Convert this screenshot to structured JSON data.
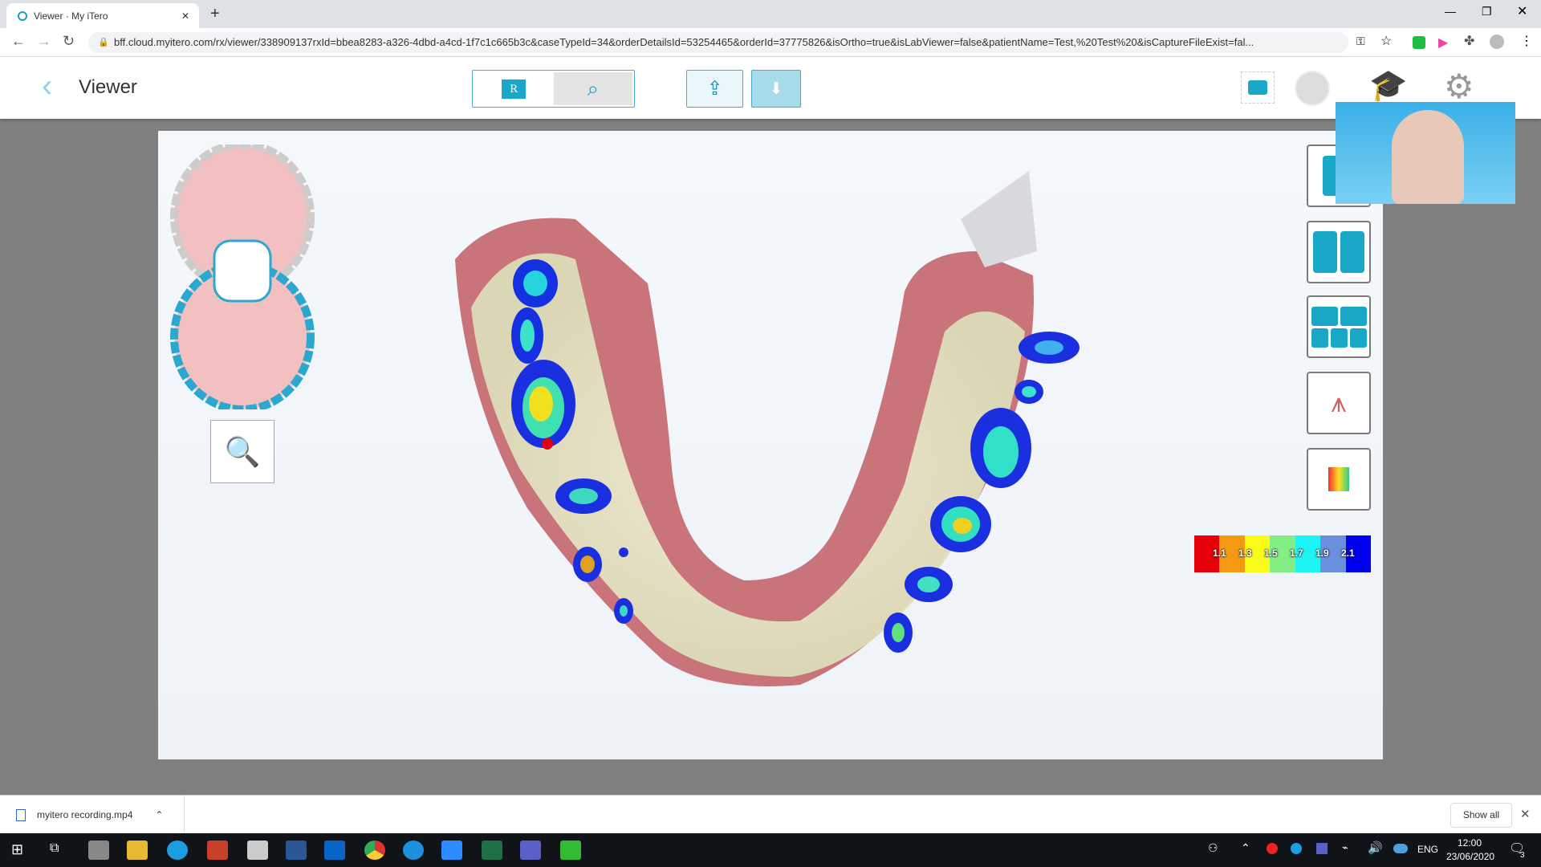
{
  "browser": {
    "tab_title": "Viewer · My iTero",
    "url": "bff.cloud.myitero.com/rx/viewer/338909137rxId=bbea8283-a326-4dbd-a4cd-1f7c1c665b3c&caseTypeId=34&orderDetailsId=53254465&orderId=37775826&isOrtho=true&isLabViewer=false&patientName=Test,%20Test%20&isCaptureFileExist=fal..."
  },
  "header": {
    "title": "Viewer",
    "restorative_label": "R"
  },
  "color_scale": {
    "labels": [
      "1.1",
      "1.3",
      "1.5",
      "1.7",
      "1.9",
      "2.1"
    ],
    "colors": [
      "#e8000a",
      "#f39a12",
      "#fbfb1a",
      "#82ee84",
      "#1ef4f4",
      "#6a8fdf",
      "#0000f0"
    ]
  },
  "accent": "#16a4c0",
  "download": {
    "file": "myitero recording.mp4",
    "show_all": "Show all"
  },
  "taskbar": {
    "lang": "ENG",
    "time": "12:00",
    "date": "23/06/2020",
    "notifications": "3"
  }
}
